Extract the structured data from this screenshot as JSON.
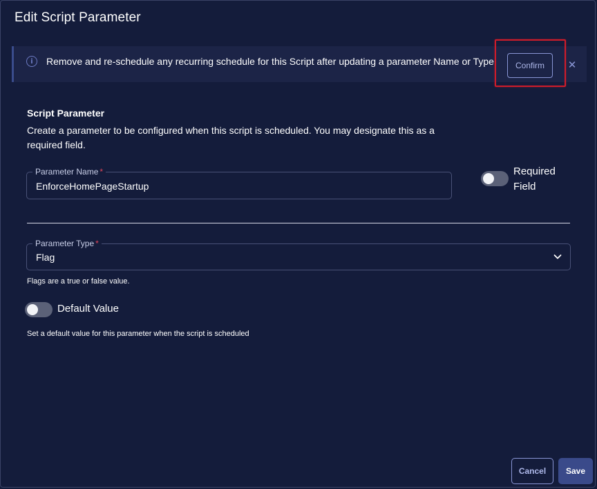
{
  "dialog": {
    "title": "Edit Script Parameter"
  },
  "banner": {
    "icon": "info-icon",
    "message": "Remove and re-schedule any recurring schedule for this Script after updating a parameter Name or Type.",
    "confirm_label": "Confirm",
    "close_icon": "close-icon",
    "highlight_color": "#d11c2a"
  },
  "section": {
    "heading": "Script Parameter",
    "description": "Create a parameter to be configured when this script is scheduled. You may designate this as a required field."
  },
  "parameter_name": {
    "label": "Parameter Name",
    "required_marker": "*",
    "value": "EnforceHomePageStartup"
  },
  "required_field": {
    "label": "Required Field",
    "enabled": false
  },
  "parameter_type": {
    "label": "Parameter Type",
    "required_marker": "*",
    "value": "Flag",
    "helper": "Flags are a true or false value.",
    "chevron_icon": "chevron-down-icon"
  },
  "default_value": {
    "label": "Default Value",
    "enabled": false,
    "helper": "Set a default value for this parameter when the script is scheduled"
  },
  "footer": {
    "cancel_label": "Cancel",
    "save_label": "Save"
  },
  "colors": {
    "background": "#141c3b",
    "accent": "#8a96d6",
    "primary_button": "#3a4a8a",
    "required": "#e0455a"
  }
}
